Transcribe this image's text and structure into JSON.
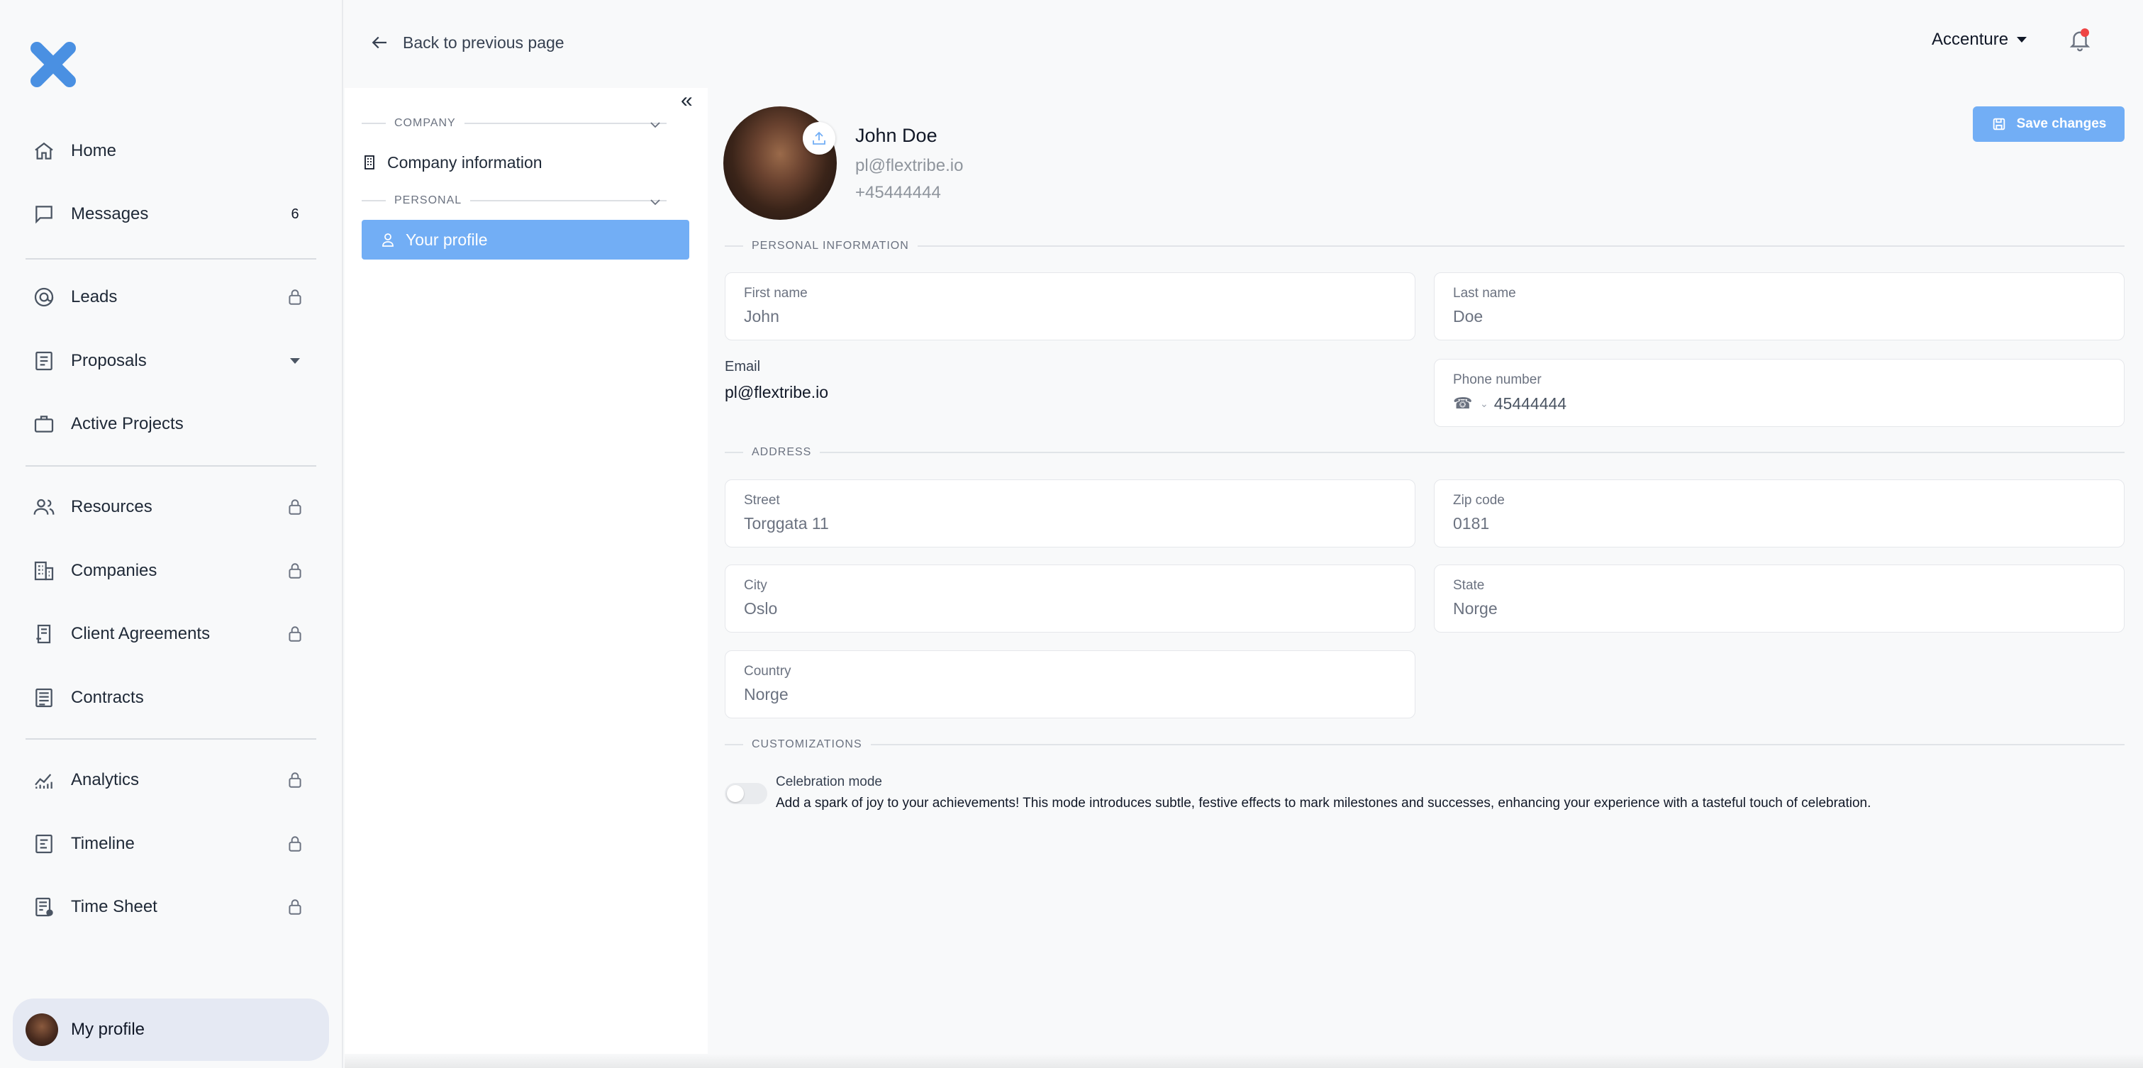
{
  "sidebar": {
    "items": [
      {
        "label": "Home",
        "icon": "home-icon"
      },
      {
        "label": "Messages",
        "icon": "message-icon",
        "badge": "6"
      },
      {
        "label": "Leads",
        "icon": "at-icon",
        "locked": true
      },
      {
        "label": "Proposals",
        "icon": "proposal-icon",
        "dropdown": true
      },
      {
        "label": "Active Projects",
        "icon": "briefcase-icon"
      },
      {
        "label": "Resources",
        "icon": "users-icon",
        "locked": true
      },
      {
        "label": "Companies",
        "icon": "building-icon",
        "locked": true
      },
      {
        "label": "Client Agreements",
        "icon": "agreement-icon",
        "locked": true
      },
      {
        "label": "Contracts",
        "icon": "contract-icon"
      },
      {
        "label": "Analytics",
        "icon": "analytics-icon",
        "locked": true
      },
      {
        "label": "Timeline",
        "icon": "timeline-icon",
        "locked": true
      },
      {
        "label": "Time Sheet",
        "icon": "timesheet-icon",
        "locked": true
      }
    ],
    "profile_label": "My profile"
  },
  "panel": {
    "back_label": "Back to previous page",
    "company_section": "COMPANY",
    "company_item": "Company information",
    "personal_section": "PERSONAL",
    "profile_item": "Your profile"
  },
  "header": {
    "org_name": "Accenture"
  },
  "profile": {
    "name": "John Doe",
    "email": "pl@flextribe.io",
    "phone": "+45444444",
    "save_label": "Save changes"
  },
  "sections": {
    "personal": "PERSONAL INFORMATION",
    "address": "ADDRESS",
    "customizations": "CUSTOMIZATIONS"
  },
  "fields": {
    "first_name": {
      "label": "First name",
      "value": "John"
    },
    "last_name": {
      "label": "Last name",
      "value": "Doe"
    },
    "email": {
      "label": "Email",
      "value": "pl@flextribe.io"
    },
    "phone": {
      "label": "Phone number",
      "value": "45444444"
    },
    "street": {
      "label": "Street",
      "value": "Torggata 11"
    },
    "zip": {
      "label": "Zip code",
      "value": "0181"
    },
    "city": {
      "label": "City",
      "value": "Oslo"
    },
    "state": {
      "label": "State",
      "value": "Norge"
    },
    "country": {
      "label": "Country",
      "value": "Norge"
    }
  },
  "customization": {
    "title": "Celebration mode",
    "description": "Add a spark of joy to your achievements! This mode introduces subtle, festive effects to mark milestones and successes, enhancing your experience with a tasteful touch of celebration.",
    "enabled": false
  },
  "colors": {
    "accent": "#72aef5",
    "logo": "#4a90e2",
    "notification_dot": "#ef4444"
  }
}
